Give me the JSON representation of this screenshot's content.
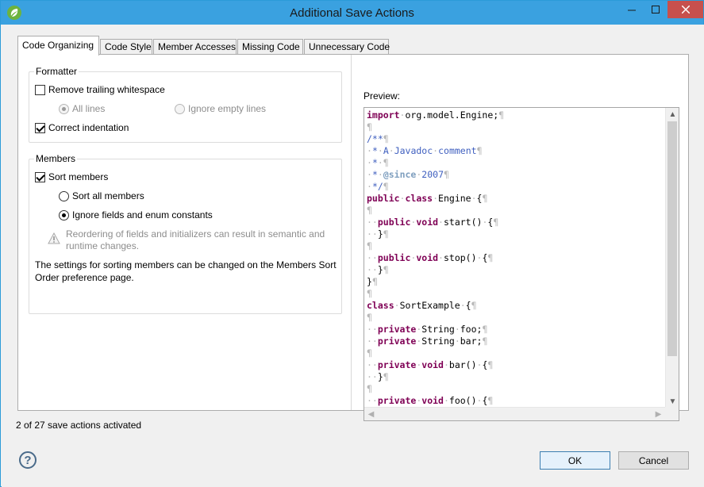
{
  "window": {
    "title": "Additional Save Actions"
  },
  "tabs": [
    {
      "label": "Code Organizing"
    },
    {
      "label": "Code Style"
    },
    {
      "label": "Member Accesses"
    },
    {
      "label": "Missing Code"
    },
    {
      "label": "Unnecessary Code"
    }
  ],
  "formatter": {
    "group_label": "Formatter",
    "remove_trailing_whitespace": "Remove trailing whitespace",
    "all_lines": "All lines",
    "ignore_empty_lines": "Ignore empty lines",
    "correct_indentation": "Correct indentation"
  },
  "members": {
    "group_label": "Members",
    "sort_members": "Sort members",
    "sort_all_members": "Sort all members",
    "ignore_fields": "Ignore fields and enum constants",
    "warning": "Reordering of fields and initializers can result in semantic and runtime changes."
  },
  "info_text": "The settings for sorting members can be changed on the Members Sort Order preference page.",
  "preview": {
    "label": "Preview:"
  },
  "status": "2 of 27 save actions activated",
  "buttons": {
    "ok": "OK",
    "cancel": "Cancel",
    "help": "?"
  }
}
